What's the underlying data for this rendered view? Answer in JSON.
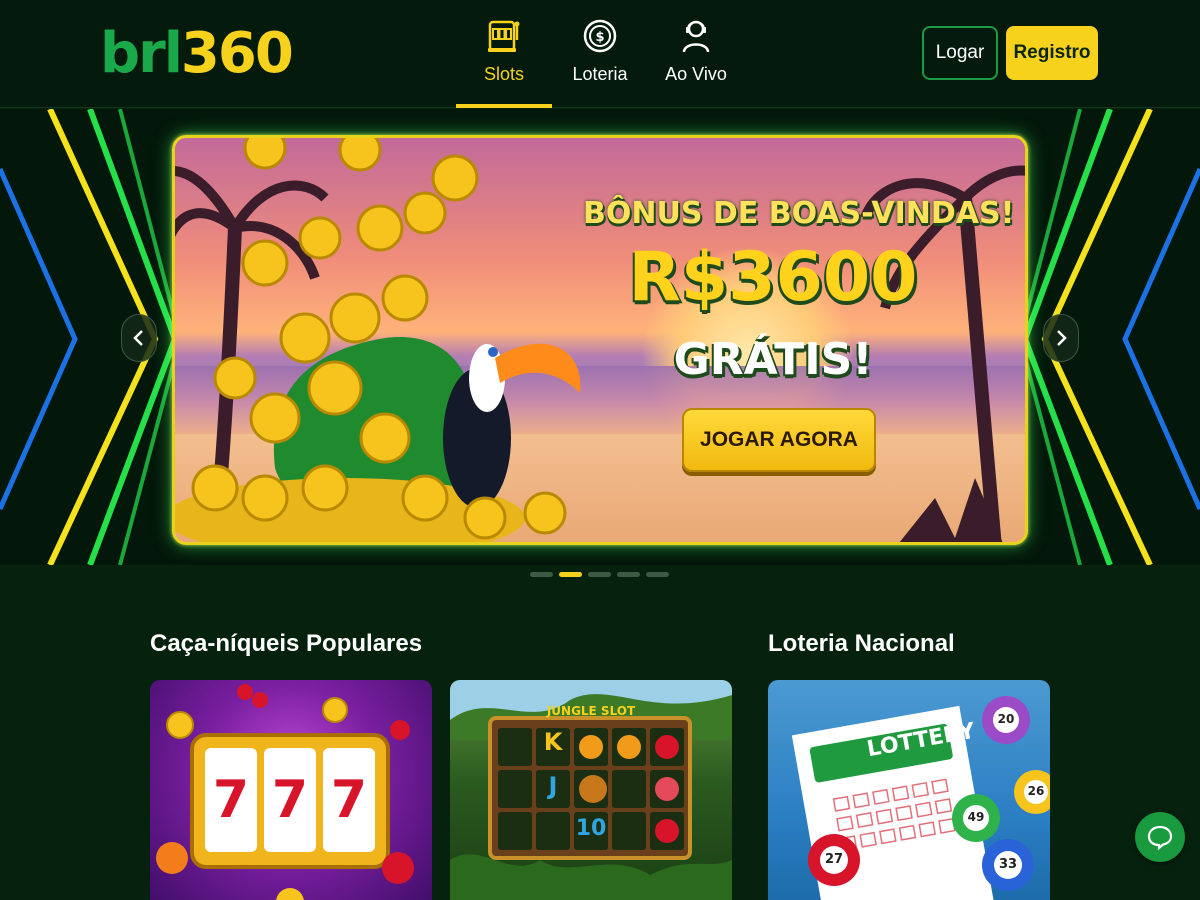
{
  "header": {
    "logo_left": "brl",
    "logo_right": "360",
    "nav": [
      {
        "label": "Slots",
        "icon": "slot-machine-icon",
        "active": true
      },
      {
        "label": "Loteria",
        "icon": "lottery-coin-icon",
        "active": false
      },
      {
        "label": "Ao Vivo",
        "icon": "live-dealer-icon",
        "active": false
      }
    ],
    "login_label": "Logar",
    "register_label": "Registro"
  },
  "hero": {
    "title": "BÔNUS DE BOAS-VINDAS!",
    "amount": "R$3600",
    "free": "GRÁTIS!",
    "cta": "JOGAR AGORA",
    "prev_icon": "chevron-left-icon",
    "next_icon": "chevron-right-icon",
    "slide_count": 5,
    "active_slide": 2
  },
  "sections": {
    "popular_slots": "Caça-níqueis Populares",
    "national_lottery": "Loteria Nacional"
  },
  "cards": {
    "slots1": {
      "reels": [
        "7",
        "7",
        "7"
      ]
    },
    "slots2": {
      "title": "JUNGLE SLOT",
      "symbols": [
        "K",
        "J",
        "10"
      ]
    },
    "lottery": {
      "title": "LOTTERY",
      "balls": [
        "20",
        "26",
        "27",
        "49",
        "33"
      ]
    }
  },
  "colors": {
    "accent": "#f6d21c",
    "brand_green": "#19a94a",
    "background": "#06220f"
  }
}
